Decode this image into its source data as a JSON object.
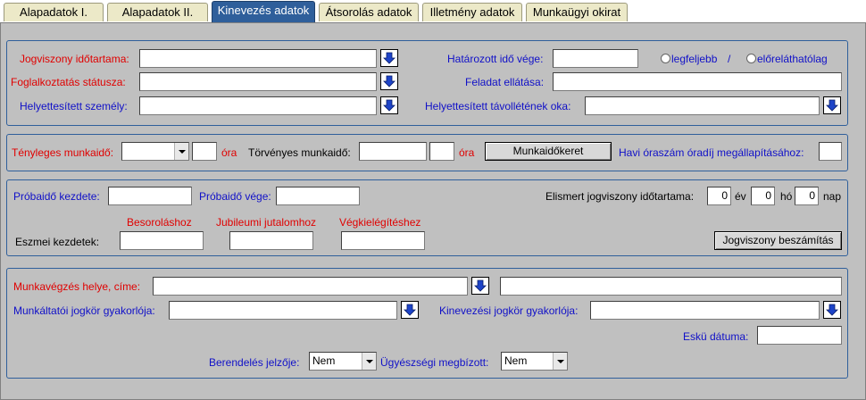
{
  "tabs": [
    {
      "label": "Alapadatok I."
    },
    {
      "label": "Alapadatok II."
    },
    {
      "label": "Kinevezés adatok"
    },
    {
      "label": "Átsorolás adatok"
    },
    {
      "label": "Illetmény adatok"
    },
    {
      "label": "Munkaügyi okirat"
    }
  ],
  "colors": {
    "accent": "#2f5f9b",
    "required_label": "#e00000",
    "optional_label": "#1010c8",
    "panel_bg": "#c0c0c0"
  },
  "section1": {
    "jogviszony_label": "Jogviszony időtartama:",
    "jogviszony_value": "",
    "foglalkoztatas_label": "Foglalkoztatás státusza:",
    "foglalkoztatas_value": "",
    "helyettesitett_label": "Helyettesített személy:",
    "helyettesitett_value": "",
    "hatarozott_label": "Határozott idő vége:",
    "hatarozott_value": "",
    "radio_legfeljebb": "legfeljebb",
    "radio_separator": "/",
    "radio_elorelathatolag": "előreláthatólag",
    "feladat_label": "Feladat ellátása:",
    "feladat_value": "",
    "tavollet_label": "Helyettesített távollétének oka:",
    "tavollet_value": ""
  },
  "section2": {
    "tenyleges_label": "Tényleges munkaidő:",
    "tenyleges_select": "",
    "tenyleges_ora_value": "",
    "ora_unit": "óra",
    "torvenyes_label": "Törvényes munkaidő:",
    "torvenyes_value": "",
    "torvenyes_ora_value": "",
    "munkaidokeret_button": "Munkaidőkeret",
    "havi_label": "Havi óraszám óradíj megállapításához:",
    "havi_value": ""
  },
  "section3": {
    "probaido_kezdete_label": "Próbaidő kezdete:",
    "probaido_kezdete_value": "",
    "probaido_vege_label": "Próbaidő vége:",
    "probaido_vege_value": "",
    "elismert_label": "Elismert jogviszony időtartama:",
    "ev_value": "0",
    "ev_unit": "év",
    "ho_value": "0",
    "ho_unit": "hó",
    "nap_value": "0",
    "nap_unit": "nap",
    "besorolashoz_label": "Besoroláshoz",
    "jubileumi_label": "Jubileumi jutalomhoz",
    "vegkielegiteshez_label": "Végkielégítéshez",
    "eszmei_label": "Eszmei kezdetek:",
    "besorolashoz_value": "",
    "jubileumi_value": "",
    "vegkielegiteshez_value": "",
    "jogviszony_beszamitas_button": "Jogviszony beszámítás"
  },
  "section4": {
    "munkavegzes_label": "Munkavégzés helye, címe:",
    "munkavegzes_value": "",
    "munkavegzes_extra_value": "",
    "munkaltatoi_label": "Munkáltatói jogkör gyakorlója:",
    "munkaltatoi_value": "",
    "kinevezesi_label": "Kinevezési jogkör gyakorlója:",
    "kinevezesi_value": "",
    "esku_label": "Eskü dátuma:",
    "esku_value": "",
    "berendeles_label": "Berendelés jelzője:",
    "berendeles_select": "Nem",
    "ugyeszsegi_label": "Ügyészségi megbízott:",
    "ugyeszsegi_select": "Nem"
  }
}
